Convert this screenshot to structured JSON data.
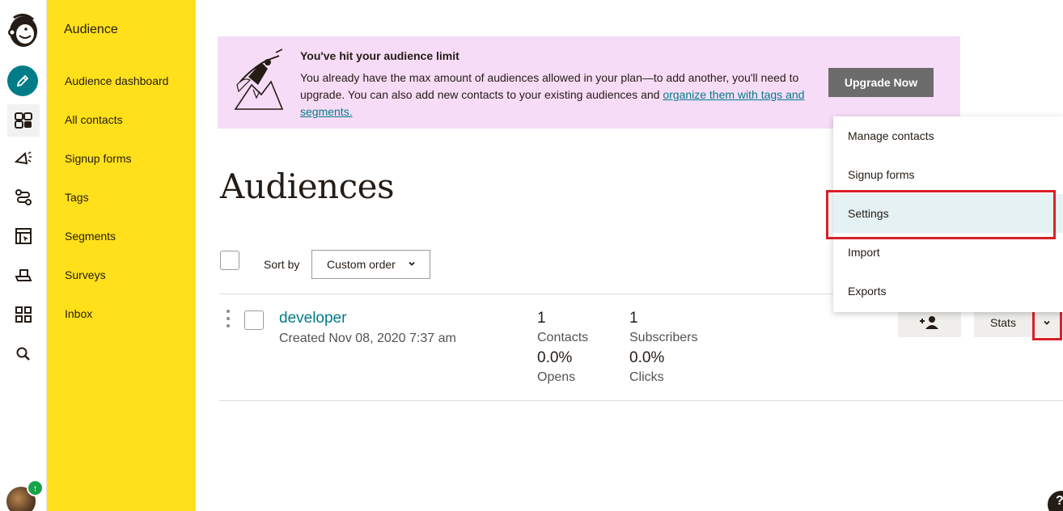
{
  "nav": {
    "title": "Audience",
    "items": [
      "Audience dashboard",
      "All contacts",
      "Signup forms",
      "Tags",
      "Segments",
      "Surveys",
      "Inbox"
    ]
  },
  "rail": {
    "icons": [
      "mailchimp-logo-icon",
      "pencil-icon",
      "audience-icon",
      "campaigns-icon",
      "automations-icon",
      "website-icon",
      "integrations-icon",
      "grid-icon",
      "search-icon"
    ]
  },
  "banner": {
    "title": "You've hit your audience limit",
    "text": "You already have the max amount of audiences allowed in your plan—to add another, you'll need to upgrade. You can also add new contacts to your existing audiences and ",
    "link": "organize them with tags and segments.",
    "upgrade_label": "Upgrade Now"
  },
  "page": {
    "title": "Audiences"
  },
  "sort": {
    "label": "Sort by",
    "selected": "Custom order"
  },
  "audience": {
    "name": "developer",
    "created": "Created Nov 08, 2020 7:37 am",
    "contacts_value": "1",
    "contacts_label": "Contacts",
    "subscribers_value": "1",
    "subscribers_label": "Subscribers",
    "opens_value": "0.0%",
    "opens_label": "Opens",
    "clicks_value": "0.0%",
    "clicks_label": "Clicks",
    "stats_label": "Stats"
  },
  "menu": {
    "items": [
      "Manage contacts",
      "Signup forms",
      "Settings",
      "Import",
      "Exports"
    ],
    "highlighted": "Settings"
  },
  "help": {
    "label": "?"
  },
  "colors": {
    "nav_bg": "#ffe01b",
    "banner_bg": "#f7dcf7",
    "link": "#007c89",
    "highlight_box": "#d9202a",
    "menu_hover": "#e5f1f3"
  }
}
